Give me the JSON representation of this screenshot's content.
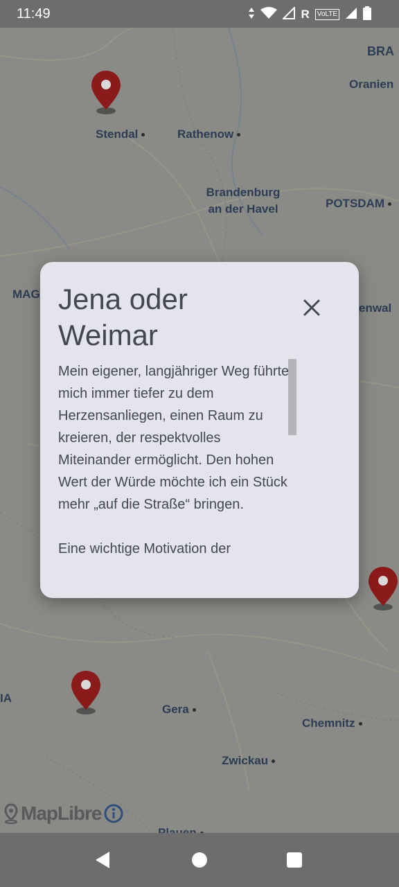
{
  "status_bar": {
    "time": "11:49",
    "icons": [
      "data-arrows-icon",
      "wifi-icon",
      "signal-icon",
      "roaming-icon",
      "volte-icon",
      "signal-icon",
      "battery-icon"
    ],
    "roaming_label": "R",
    "volte_label": "VoLTE"
  },
  "map": {
    "cities": [
      {
        "name": "Stendal"
      },
      {
        "name": "Rathenow"
      },
      {
        "name": "Brandenburg an der Havel"
      },
      {
        "name": "POTSDAM"
      },
      {
        "name": "Oranien"
      },
      {
        "name": "BRA"
      },
      {
        "name": "MAG"
      },
      {
        "name": "enwal"
      },
      {
        "name": "Gera"
      },
      {
        "name": "Chemnitz"
      },
      {
        "name": "Zwickau"
      },
      {
        "name": "Plauen"
      },
      {
        "name": "IA"
      }
    ],
    "markers": 3,
    "attribution": "MapLibre",
    "colors": {
      "marker": "#8b1a1a",
      "label": "#2d3c55",
      "overlay": "#7a7a76"
    }
  },
  "dialog": {
    "title": "Jena oder Weimar",
    "paragraphs": [
      "Mein eigener, langjähriger Weg führte mich immer tiefer zu dem Herzensanliegen, einen Raum zu kreieren, der respektvolles Miteinander ermöglicht. Den hohen Wert der Würde möchte ich ein Stück mehr „auf die Straße“ bringen.",
      "Eine wichtige Motivation der"
    ],
    "close_icon": "close-icon"
  },
  "nav_bar": {
    "buttons": [
      "back-icon",
      "home-icon",
      "recents-icon"
    ]
  }
}
